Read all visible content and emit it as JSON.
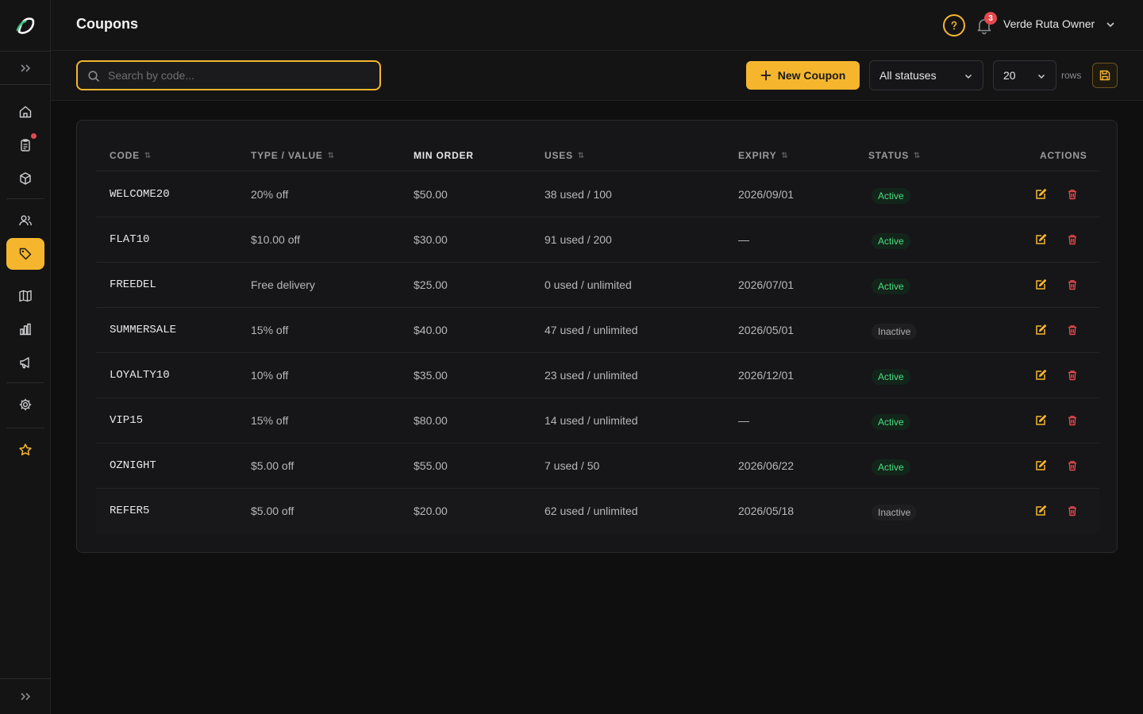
{
  "header": {
    "title": "Coupons",
    "notifications_count": "3",
    "user_name": "Verde Ruta Owner"
  },
  "toolbar": {
    "search_placeholder": "Search by code...",
    "new_button_label": "New Coupon",
    "status_filter": "All statuses",
    "rows_per_page": "20",
    "rows_label": "rows"
  },
  "sidebar": {
    "items": [
      {
        "icon": "home-icon"
      },
      {
        "icon": "orders-icon",
        "has_dot": true
      },
      {
        "icon": "box-icon"
      },
      {
        "icon": "users-icon"
      },
      {
        "icon": "tag-icon",
        "active": true
      },
      {
        "icon": "map-icon"
      },
      {
        "icon": "bar-chart-icon"
      },
      {
        "icon": "megaphone-icon"
      },
      {
        "icon": "gear-icon"
      },
      {
        "icon": "star-icon"
      }
    ]
  },
  "table": {
    "columns": {
      "code": "CODE",
      "type_value": "TYPE / VALUE",
      "min_order": "MIN ORDER",
      "uses": "USES",
      "expiry": "EXPIRY",
      "status": "STATUS",
      "actions": "ACTIONS"
    },
    "rows": [
      {
        "code": "WELCOME20",
        "type_value": "20% off",
        "min_order": "$50.00",
        "uses": "38 used / 100",
        "expiry": "2026/09/01",
        "status": "Active"
      },
      {
        "code": "FLAT10",
        "type_value": "$10.00 off",
        "min_order": "$30.00",
        "uses": "91 used / 200",
        "expiry": "—",
        "status": "Active"
      },
      {
        "code": "FREEDEL",
        "type_value": "Free delivery",
        "min_order": "$25.00",
        "uses": "0 used / unlimited",
        "expiry": "2026/07/01",
        "status": "Active"
      },
      {
        "code": "SUMMERSALE",
        "type_value": "15% off",
        "min_order": "$40.00",
        "uses": "47 used / unlimited",
        "expiry": "2026/05/01",
        "status": "Inactive"
      },
      {
        "code": "LOYALTY10",
        "type_value": "10% off",
        "min_order": "$35.00",
        "uses": "23 used / unlimited",
        "expiry": "2026/12/01",
        "status": "Active"
      },
      {
        "code": "VIP15",
        "type_value": "15% off",
        "min_order": "$80.00",
        "uses": "14 used / unlimited",
        "expiry": "—",
        "status": "Active"
      },
      {
        "code": "OZNIGHT",
        "type_value": "$5.00 off",
        "min_order": "$55.00",
        "uses": "7 used / 50",
        "expiry": "2026/06/22",
        "status": "Active"
      },
      {
        "code": "REFER5",
        "type_value": "$5.00 off",
        "min_order": "$20.00",
        "uses": "62 used / unlimited",
        "expiry": "2026/05/18",
        "status": "Inactive"
      }
    ]
  },
  "colors": {
    "accent": "#f5b62e",
    "active_status": "#4ade80",
    "delete": "#e5484d",
    "background": "#0f0f10"
  }
}
